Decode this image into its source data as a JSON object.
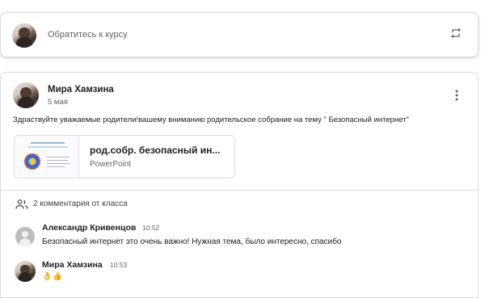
{
  "share": {
    "placeholder": "Обратитесь к курсу",
    "repost_icon": "repost-icon"
  },
  "post": {
    "author": "Мира Хамзина",
    "date": "5 мая",
    "text": "Здраствуйте уважаемые родители!вашему вниманию родительское собрание на тему \" Безопасный интернет\"",
    "more_icon": "more-vert-icon",
    "attachment": {
      "title": "род.собр. безопасный ин...",
      "type": "PowerPoint"
    }
  },
  "comments": {
    "header": "2 комментария от класса",
    "items": [
      {
        "author": "Александр Кривенцов",
        "time": "10:52",
        "text": "Безопасный интернет это очень важно! Нужная тема, было интересно, спасибо"
      },
      {
        "author": "Мира Хамзина",
        "time": "10:53",
        "text": "👌👍"
      }
    ]
  },
  "colors": {
    "border": "#dadce0",
    "secondary_text": "#5f6368",
    "primary_text": "#202124"
  }
}
